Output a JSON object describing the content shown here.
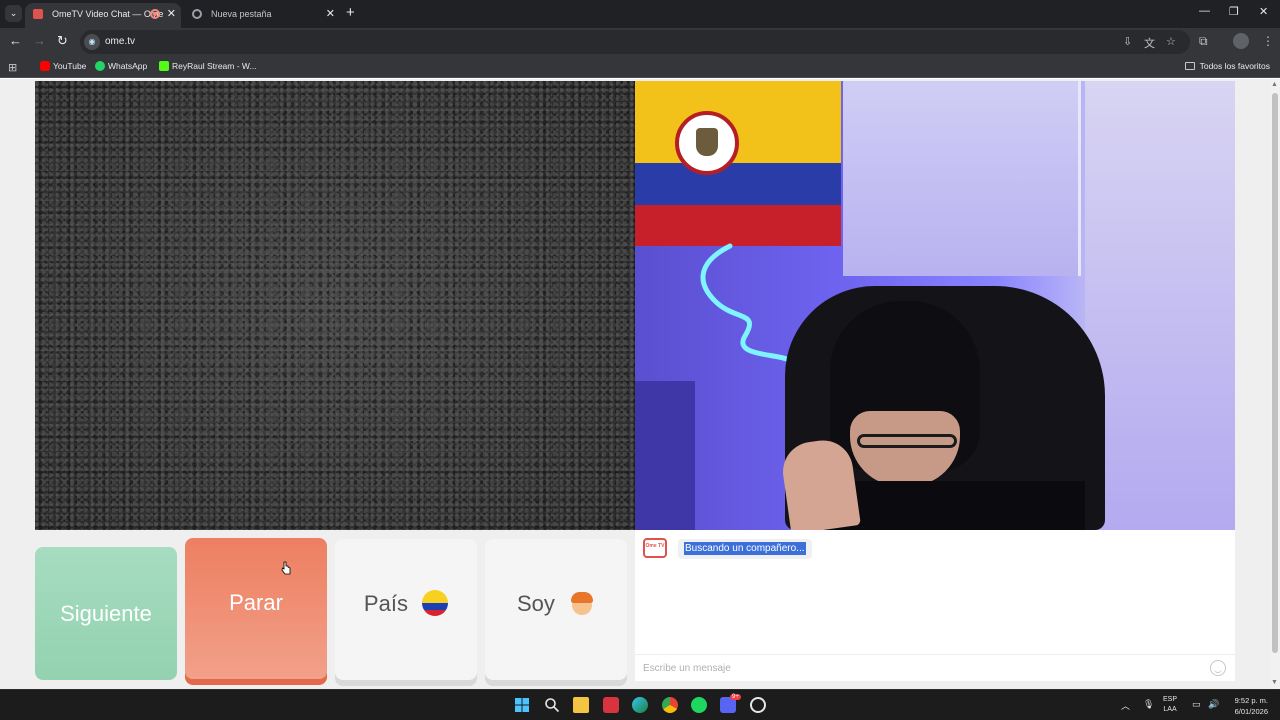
{
  "browser": {
    "tabs": [
      {
        "title": "OmeTV Video Chat — Ome",
        "active": true
      },
      {
        "title": "Nueva pestaña",
        "active": false
      }
    ],
    "url": "ome.tv",
    "bookmarks": [
      {
        "label": "YouTube",
        "color": "#ff0000"
      },
      {
        "label": "WhatsApp",
        "color": "#25d366"
      },
      {
        "label": "ReyRaul Stream - W...",
        "color": "#53fc18"
      }
    ],
    "all_bookmarks_label": "Todos los favoritos"
  },
  "controls": {
    "next_label": "Siguiente",
    "stop_label": "Parar",
    "country_label": "País",
    "gender_label": "Soy"
  },
  "chat": {
    "logo_text": "Ome TV",
    "status_message": "Buscando un compañero...",
    "input_placeholder": "Escribe un mensaje"
  },
  "taskbar": {
    "language": "ESP",
    "layout": "LAA",
    "time": "9:52 p. m.",
    "date": "6/01/2026",
    "discord_badge": "9+"
  },
  "colors": {
    "next_button": "#9fd8bb",
    "stop_button": "#ef8a6d",
    "highlight": "#3c6fd8"
  }
}
